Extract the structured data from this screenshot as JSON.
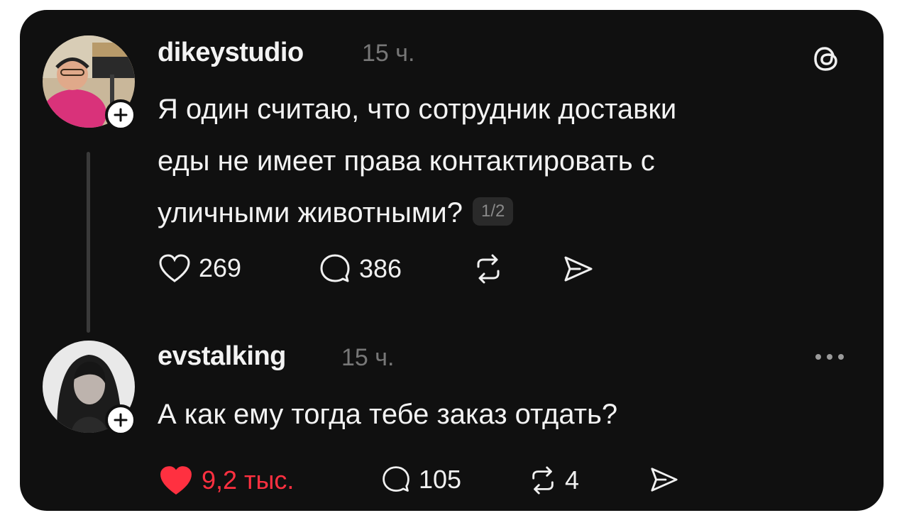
{
  "post": {
    "username": "dikeystudio",
    "time": "15 ч.",
    "text_lines": [
      "Я один считаю, что сотрудник доставки",
      "еды не имеет права контактировать с",
      "уличными животными?"
    ],
    "page_badge": "1/2",
    "likes": "269",
    "replies": "386",
    "icons": [
      "threads-logo-icon",
      "plus-icon",
      "heart-icon",
      "comment-icon",
      "repost-icon",
      "share-icon"
    ]
  },
  "reply": {
    "username": "evstalking",
    "time": "15 ч.",
    "text": "А как ему тогда тебе заказ отдать?",
    "likes": "9,2 тыс.",
    "replies": "105",
    "reposts": "4",
    "icons": [
      "more-icon",
      "plus-icon",
      "heart-filled-icon",
      "comment-icon",
      "repost-icon",
      "share-icon"
    ]
  },
  "colors": {
    "background": "#101010",
    "text": "#f3f3f3",
    "muted": "#777777",
    "like_active": "#ff3040"
  }
}
